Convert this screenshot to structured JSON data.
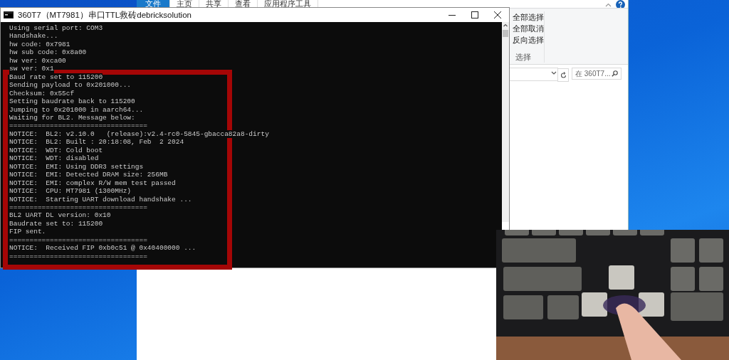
{
  "explorer": {
    "ribbon_tabs": [
      {
        "label": "文件",
        "selected": true
      },
      {
        "label": "主页",
        "selected": false
      },
      {
        "label": "共享",
        "selected": false
      },
      {
        "label": "查看",
        "selected": false
      },
      {
        "label": "应用程序工具",
        "selected": false
      }
    ],
    "select_commands": [
      "全部选择",
      "全部取消",
      "反向选择"
    ],
    "group_label": "选择",
    "search": {
      "placeholder": "在 360T7..."
    }
  },
  "console": {
    "title": "360T7（MT7981）串口TTL救砖debricksolution",
    "lines": [
      "Using serial port: COM3",
      "Handshake...",
      "hw code: 0x7981",
      "hw sub code: 0x8a00",
      "hw ver: 0xca00",
      "sw ver: 0x1",
      "Baud rate set to 115200",
      "Sending payload to 0x201000...",
      "Checksum: 0x55cf",
      "Setting baudrate back to 115200",
      "Jumping to 0x201000 in aarch64...",
      "Waiting for BL2. Message below:",
      "==================================",
      "NOTICE:  BL2: v2.10.0   (release):v2.4-rc0-5845-gbacca82a8-dirty",
      "NOTICE:  BL2: Built : 20:18:08, Feb  2 2024",
      "NOTICE:  WDT: Cold boot",
      "NOTICE:  WDT: disabled",
      "NOTICE:  EMI: Using DDR3 settings",
      "NOTICE:  EMI: Detected DRAM size: 256MB",
      "NOTICE:  EMI: complex R/W mem test passed",
      "NOTICE:  CPU: MT7981 (1300MHz)",
      "NOTICE:  Starting UART download handshake ...",
      "==================================",
      "BL2 UART DL version: 0x10",
      "Baudrate set to: 115200",
      "FIP sent.",
      "==================================",
      "NOTICE:  Received FIP 0xb0c51 @ 0x40400000 ...",
      "=================================="
    ]
  }
}
